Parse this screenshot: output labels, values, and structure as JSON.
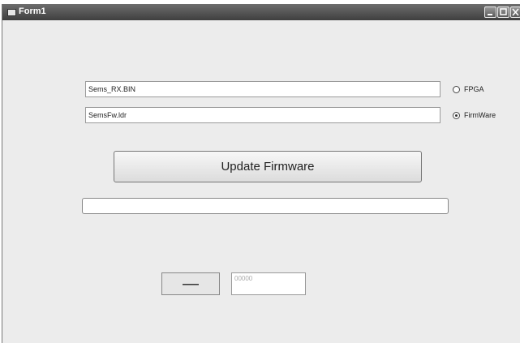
{
  "window": {
    "title": "Form1"
  },
  "inputs": {
    "fpga_file": {
      "value": "Sems_RX.BIN"
    },
    "firmware_file": {
      "value": "SemsFw.ldr"
    }
  },
  "radios": {
    "fpga": {
      "label": "FPGA",
      "checked": false
    },
    "firmware": {
      "label": "FirmWare",
      "checked": true
    }
  },
  "update_button": {
    "label": "Update Firmware"
  },
  "progress": {
    "value": 0
  },
  "status": {
    "text": "—"
  },
  "counter": {
    "placeholder": "00000"
  }
}
